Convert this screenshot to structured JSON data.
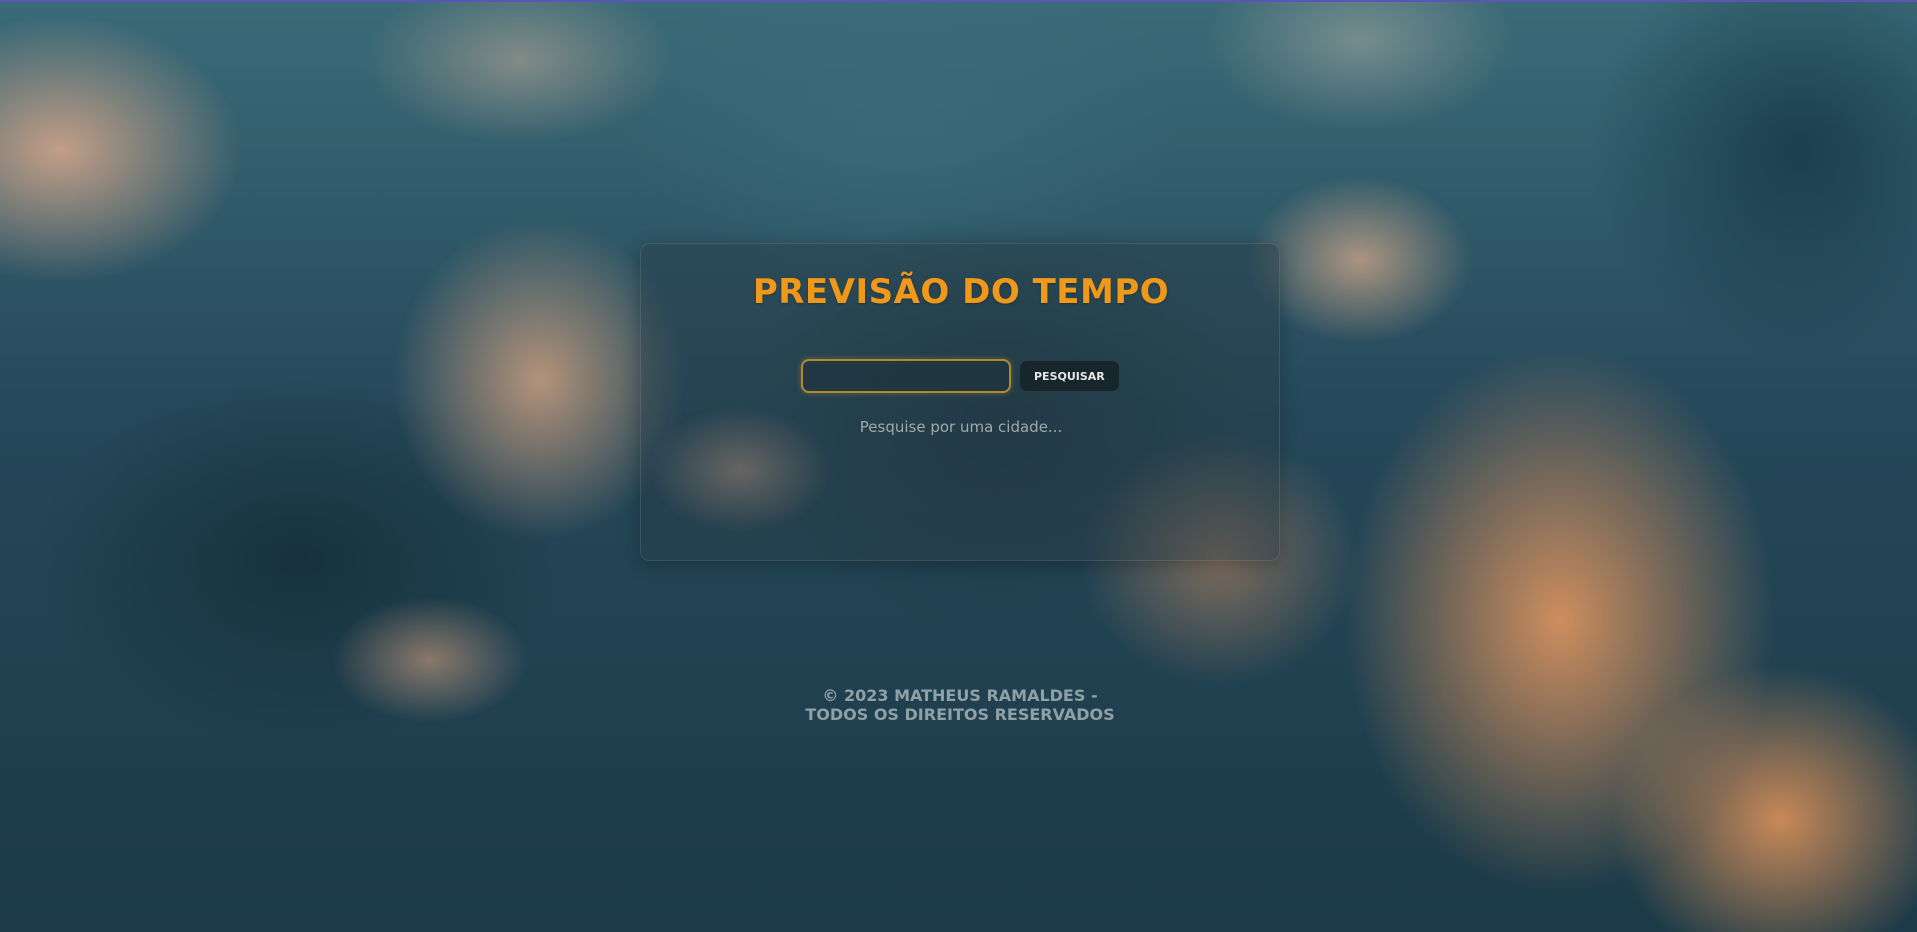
{
  "app": {
    "title": "PREVISÃO DO TEMPO"
  },
  "search": {
    "value": "",
    "placeholder": "",
    "button_label": "PESQUISAR",
    "hint": "Pesquise por uma cidade..."
  },
  "footer": {
    "text": "© 2023 MATHEUS RAMALDES - TODOS OS DIREITOS RESERVADOS"
  },
  "colors": {
    "accent": "#f0981a",
    "button_bg": "#16262b",
    "input_border": "#b08a2a"
  }
}
